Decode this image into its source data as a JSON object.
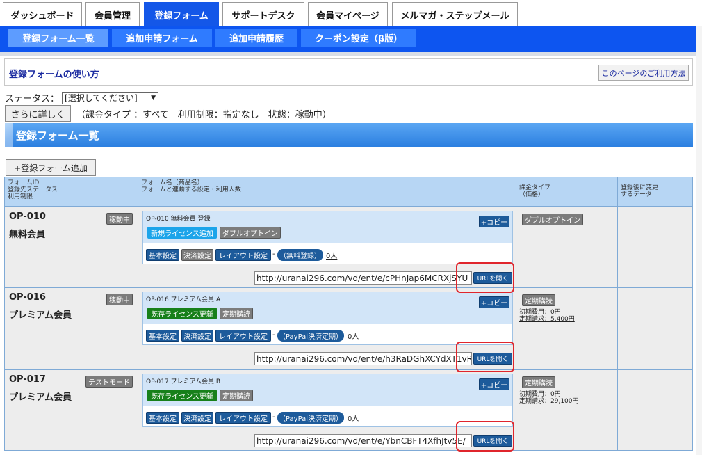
{
  "top_tabs": [
    "ダッシュボード",
    "会員管理",
    "登録フォーム",
    "サポートデスク",
    "会員マイページ",
    "メルマガ・ステップメール"
  ],
  "active_tab": "登録フォーム",
  "sub_tabs": [
    "登録フォーム一覧",
    "追加申請フォーム",
    "追加申請履歴",
    "クーポン設定（β版）"
  ],
  "help": {
    "title": "登録フォームの使い方",
    "link": "このページのご利用方法"
  },
  "filter": {
    "status_label": "ステータス：",
    "status_value": "[選択してください]",
    "detail_button": "さらに詳しく",
    "summary": "（課金タイプ ：すべて　利用制限：指定なし　状態：稼動中）"
  },
  "section_title": "登録フォーム一覧",
  "add_button": "+登録フォーム追加",
  "columns": {
    "c1": [
      "フォームID",
      "登録先ステータス",
      "利用制限"
    ],
    "c2": [
      "フォーム名（商品名）",
      "フォームと連動する設定・利用人数"
    ],
    "c3": [
      "課金タイプ",
      "（価格）"
    ],
    "c4": [
      "登録後に変更",
      "するデータ"
    ]
  },
  "rows": [
    {
      "id": "OP-010",
      "name": "無料会員",
      "state": "稼動中",
      "form_title": "OP-010 無料会員 登録",
      "license": "新規ライセンス追加",
      "license_color": "#1ba4ea",
      "type_chip": "ダブルオプトイン",
      "copy": "+コピー",
      "settings": [
        "基本設定",
        "決済設定",
        "レイアウト設定"
      ],
      "payment": "（無料登録）",
      "count": "0人",
      "url": "http://uranai296.com/vd/ent/e/cPHnJap6MCRXjSYU",
      "url_button": "URLを開く",
      "billing": "ダブルオプトイン",
      "price_initial": "",
      "price_regular": ""
    },
    {
      "id": "OP-016",
      "name": "プレミアム会員",
      "state": "稼動中",
      "form_title": "OP-016 プレミアム会員 A",
      "license": "既存ライセンス更新",
      "license_color": "#17801a",
      "type_chip": "定期購読",
      "copy": "+コピー",
      "settings": [
        "基本設定",
        "決済設定",
        "レイアウト設定"
      ],
      "payment": "（PayPal決済定期）",
      "count": "0人",
      "url": "http://uranai296.com/vd/ent/e/h3RaDGhXCYdXT1vR",
      "url_button": "URLを開く",
      "billing": "定期購読",
      "price_initial": "初期費用：0円",
      "price_regular": "定期請求：5,400円"
    },
    {
      "id": "OP-017",
      "name": "プレミアム会員",
      "state": "テストモード",
      "form_title": "OP-017 プレミアム会員 B",
      "license": "既存ライセンス更新",
      "license_color": "#17801a",
      "type_chip": "定期購読",
      "copy": "+コピー",
      "settings": [
        "基本設定",
        "決済設定",
        "レイアウト設定"
      ],
      "payment": "（PayPal決済定期）",
      "count": "0人",
      "url": "http://uranai296.com/vd/ent/e/YbnCBFT4XfhJtv5E/",
      "url_button": "URLを開く",
      "billing": "定期購読",
      "price_initial": "初期費用：0円",
      "price_regular": "定期請求：29,100円"
    }
  ],
  "colors": {
    "accent": "#0d55f0",
    "header_bg": "#b7d6f4",
    "highlight": "#e0252c"
  }
}
